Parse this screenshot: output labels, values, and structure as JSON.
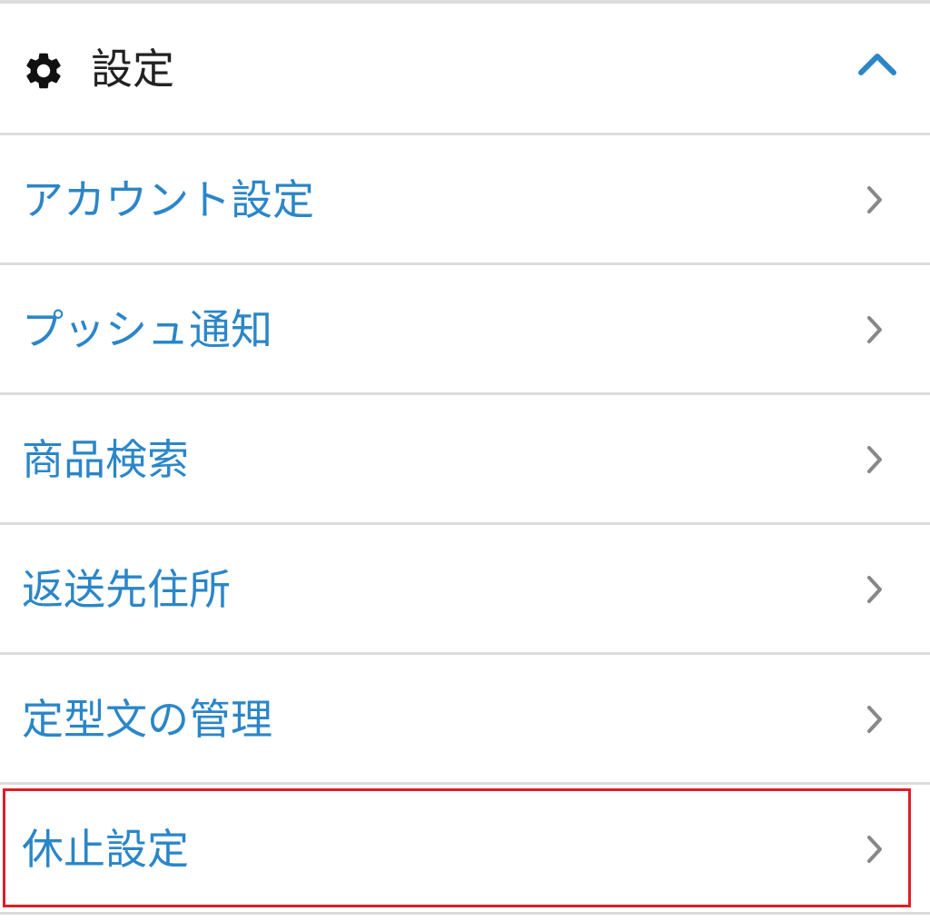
{
  "header": {
    "title": "設定",
    "icon": "gear-icon",
    "toggle_icon": "chevron-up-icon",
    "accent_color": "#2b86c8"
  },
  "menu": {
    "items": [
      {
        "label": "アカウント設定",
        "icon": "chevron-right-icon"
      },
      {
        "label": "プッシュ通知",
        "icon": "chevron-right-icon"
      },
      {
        "label": "商品検索",
        "icon": "chevron-right-icon"
      },
      {
        "label": "返送先住所",
        "icon": "chevron-right-icon"
      },
      {
        "label": "定型文の管理",
        "icon": "chevron-right-icon"
      },
      {
        "label": "休止設定",
        "icon": "chevron-right-icon"
      }
    ],
    "highlighted_item": "休止設定",
    "highlight_color": "#e01e2a"
  }
}
